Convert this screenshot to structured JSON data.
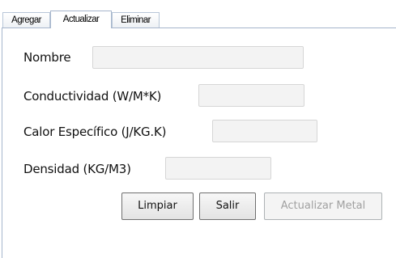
{
  "tabs": [
    {
      "label": "Agregar"
    },
    {
      "label": "Actualizar",
      "active": true
    },
    {
      "label": "Eliminar"
    }
  ],
  "form": {
    "nombre_label": "Nombre",
    "nombre_value": "",
    "conductividad_label": "Conductividad (W/M*K)",
    "conductividad_value": "",
    "calor_label": "Calor Específico (J/KG.K)",
    "calor_value": "",
    "densidad_label": "Densidad (KG/M3)",
    "densidad_value": ""
  },
  "buttons": {
    "limpiar": "Limpiar",
    "salir": "Salir",
    "actualizar": "Actualizar Metal",
    "actualizar_enabled": false
  }
}
